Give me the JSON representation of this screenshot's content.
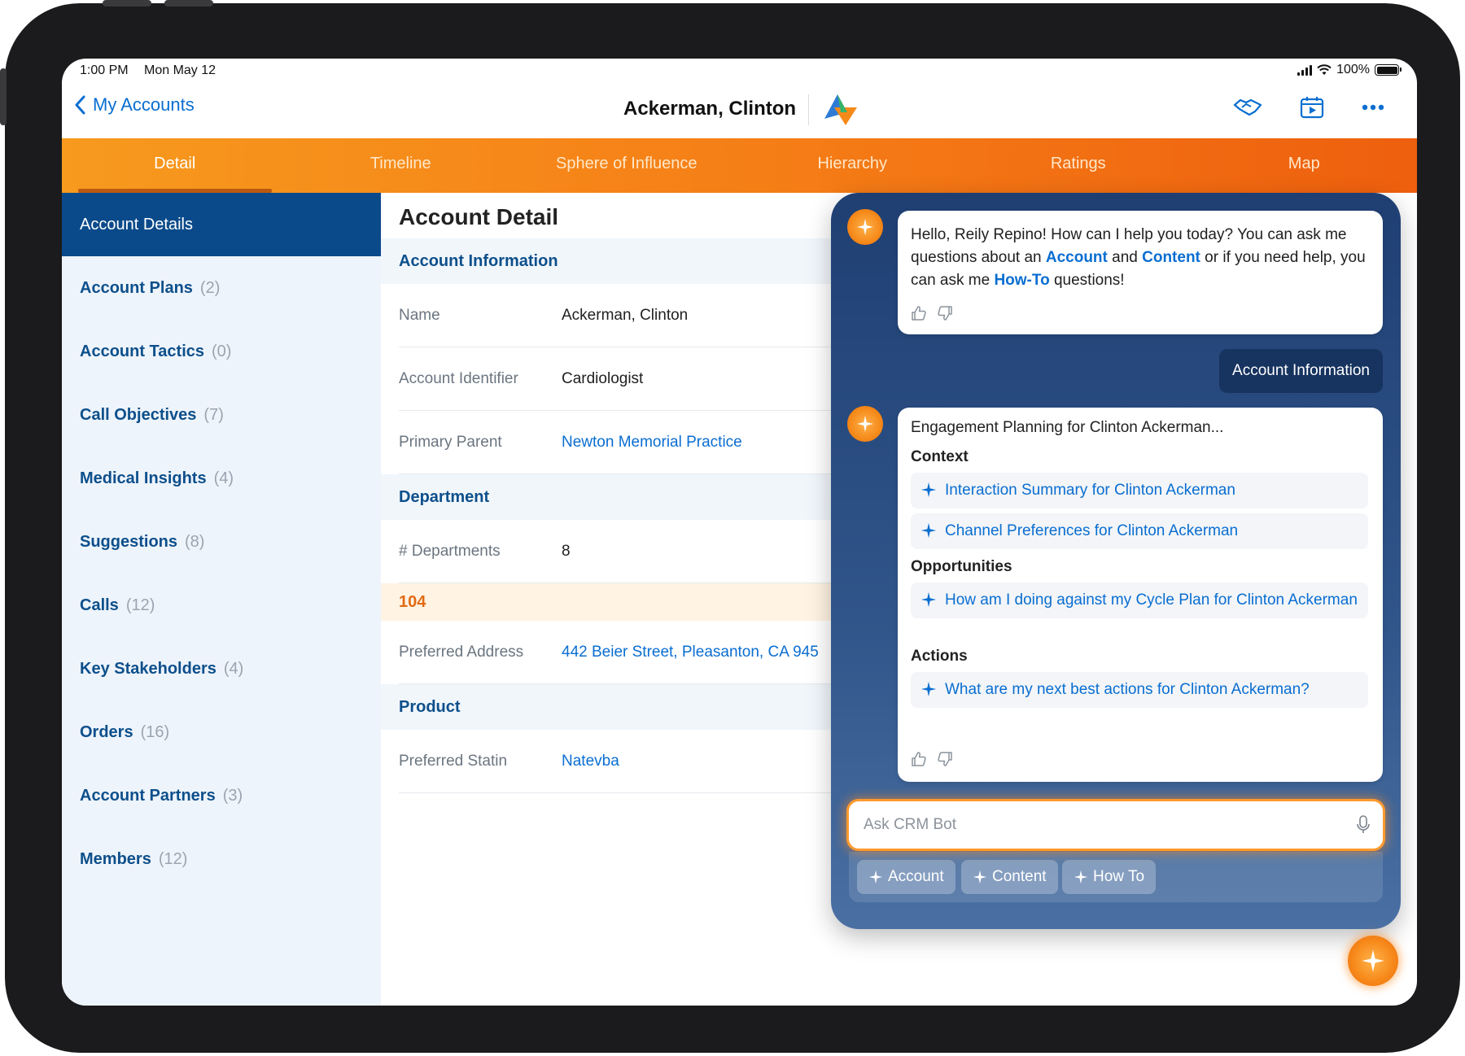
{
  "status_bar": {
    "time": "1:00 PM",
    "date": "Mon May 12",
    "battery": "100%"
  },
  "nav": {
    "back_label": "My Accounts",
    "title": "Ackerman, Clinton",
    "icons": [
      "handshake-icon",
      "calendar-play-icon",
      "more-icon"
    ]
  },
  "tabs": [
    {
      "label": "Detail",
      "active": true
    },
    {
      "label": "Timeline"
    },
    {
      "label": "Sphere of Influence"
    },
    {
      "label": "Hierarchy"
    },
    {
      "label": "Ratings"
    },
    {
      "label": "Map"
    }
  ],
  "sidebar": {
    "items": [
      {
        "label": "Account Details",
        "count": ""
      },
      {
        "label": "Account Plans",
        "count": "(2)"
      },
      {
        "label": "Account Tactics",
        "count": "(0)"
      },
      {
        "label": "Call Objectives",
        "count": "(7)"
      },
      {
        "label": "Medical Insights",
        "count": "(4)"
      },
      {
        "label": "Suggestions",
        "count": "(8)"
      },
      {
        "label": "Calls",
        "count": "(12)"
      },
      {
        "label": "Key Stakeholders",
        "count": "(4)"
      },
      {
        "label": "Orders",
        "count": "(16)"
      },
      {
        "label": "Account Partners",
        "count": "(3)"
      },
      {
        "label": "Members",
        "count": "(12)"
      }
    ]
  },
  "detail": {
    "title": "Account Detail",
    "account_info": {
      "header": "Account Information",
      "name_label": "Name",
      "name_value": "Ackerman, Clinton",
      "identifier_label": "Account Identifier",
      "identifier_value": "Cardiologist",
      "parent_label": "Primary Parent",
      "parent_value": "Newton Memorial Practice"
    },
    "department": {
      "header": "Department",
      "count_label": "# Departments",
      "count_value": "8",
      "highlight": "104",
      "address_label": "Preferred Address",
      "address_value": "442 Beier Street, Pleasanton, CA 945"
    },
    "product": {
      "header": "Product",
      "statin_label": "Preferred Statin",
      "statin_value": "Natevba"
    }
  },
  "chat": {
    "greeting": {
      "part1": "Hello, Reily Repino! How can I help you today? You can ask me questions about an ",
      "kw1": "Account",
      "part2": " and ",
      "kw2": "Content",
      "part3": " or if you need help, you can ask me ",
      "kw3": "How-To",
      "part4": " questions!"
    },
    "user_message": "Account Information",
    "response": {
      "intro": "Engagement Planning for Clinton Ackerman...",
      "context_header": "Context",
      "context_items": [
        "Interaction Summary for Clinton Ackerman",
        "Channel Preferences for Clinton Ackerman"
      ],
      "opportunities_header": "Opportunities",
      "opportunity_items": [
        "How am I doing against my Cycle Plan for Clinton Ackerman"
      ],
      "actions_header": "Actions",
      "action_items": [
        "What are my next best actions for Clinton Ackerman?"
      ]
    },
    "input_placeholder": "Ask CRM Bot",
    "chips": [
      "Account",
      "Content",
      "How To"
    ]
  },
  "colors": {
    "accent_orange": "#f57c16",
    "brand_blue": "#0b4a8a",
    "link_blue": "#0a6ed1"
  }
}
